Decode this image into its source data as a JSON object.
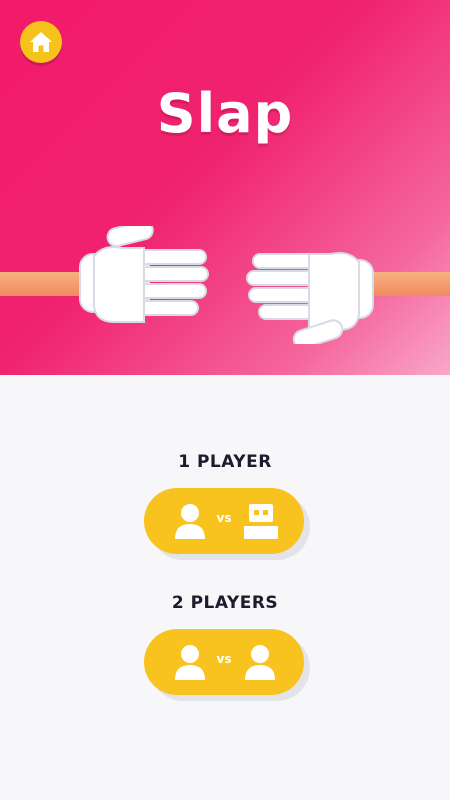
{
  "game": {
    "title": "Slap"
  },
  "icons": {
    "home": "home-icon",
    "player": "person-icon",
    "cpu": "robot-icon"
  },
  "modes": [
    {
      "label": "1 PLAYER",
      "vs": "vs",
      "left_icon": "person-icon",
      "right_icon": "robot-icon"
    },
    {
      "label": "2 PLAYERS",
      "vs": "vs",
      "left_icon": "person-icon",
      "right_icon": "person-icon"
    }
  ],
  "colors": {
    "hero_pink": "#f21a6a",
    "button_yellow": "#f8c21f",
    "panel_bg": "#f7f7fa",
    "label_text": "#1f1b2e"
  }
}
